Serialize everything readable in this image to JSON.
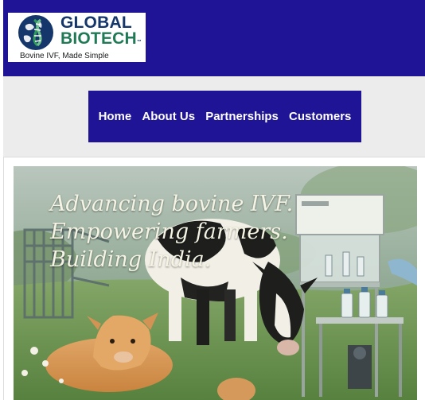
{
  "brand": {
    "name_line1": "GLOBAL",
    "name_line2": "BIOTECH",
    "trademark": "™",
    "tagline": "Bovine IVF, Made Simple",
    "logo_icon": "globe-dna-icon"
  },
  "nav": {
    "items": [
      {
        "label": "Home"
      },
      {
        "label": "About Us"
      },
      {
        "label": "Partnerships"
      },
      {
        "label": "Customers"
      }
    ]
  },
  "hero": {
    "lines": [
      "Advancing bovine IVF.",
      "Empowering farmers.",
      "Building India."
    ]
  },
  "colors": {
    "header_bg": "#1f1396",
    "nav_bg": "#1f1396",
    "brand_navy": "#14366b",
    "brand_green": "#2f9a5a"
  }
}
